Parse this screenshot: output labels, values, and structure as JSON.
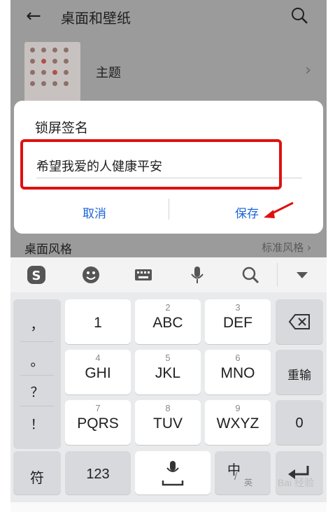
{
  "header": {
    "title": "桌面和壁纸"
  },
  "theme_row": {
    "label": "主题"
  },
  "style_row": {
    "label": "桌面风格",
    "value": "标准风格"
  },
  "dialog": {
    "title": "锁屏签名",
    "input_value": "希望我爱的人健康平安",
    "cancel_label": "取消",
    "save_label": "保存"
  },
  "keyboard": {
    "punct": [
      "，",
      "。",
      "？",
      "！"
    ],
    "keys": [
      {
        "name": "key-1",
        "sup": "",
        "main": "1"
      },
      {
        "name": "key-abc",
        "sup": "2",
        "main": "ABC"
      },
      {
        "name": "key-def",
        "sup": "3",
        "main": "DEF"
      },
      {
        "name": "key-ghi",
        "sup": "4",
        "main": "GHI"
      },
      {
        "name": "key-jkl",
        "sup": "5",
        "main": "JKL"
      },
      {
        "name": "key-mno",
        "sup": "6",
        "main": "MNO"
      },
      {
        "name": "key-pqrs",
        "sup": "7",
        "main": "PQRS"
      },
      {
        "name": "key-tuv",
        "sup": "8",
        "main": "TUV"
      },
      {
        "name": "key-wxyz",
        "sup": "9",
        "main": "WXYZ"
      }
    ],
    "reinput_label": "重输",
    "zero_label": "0",
    "symbol_label": "符",
    "num_label": "123",
    "lang_main": "中",
    "lang_sub": "英"
  },
  "watermark": "Bai 经验",
  "colors": {
    "dialog_button": "#1a63d9",
    "highlight_box": "#e01010",
    "overlay": "#9b9b9b"
  }
}
